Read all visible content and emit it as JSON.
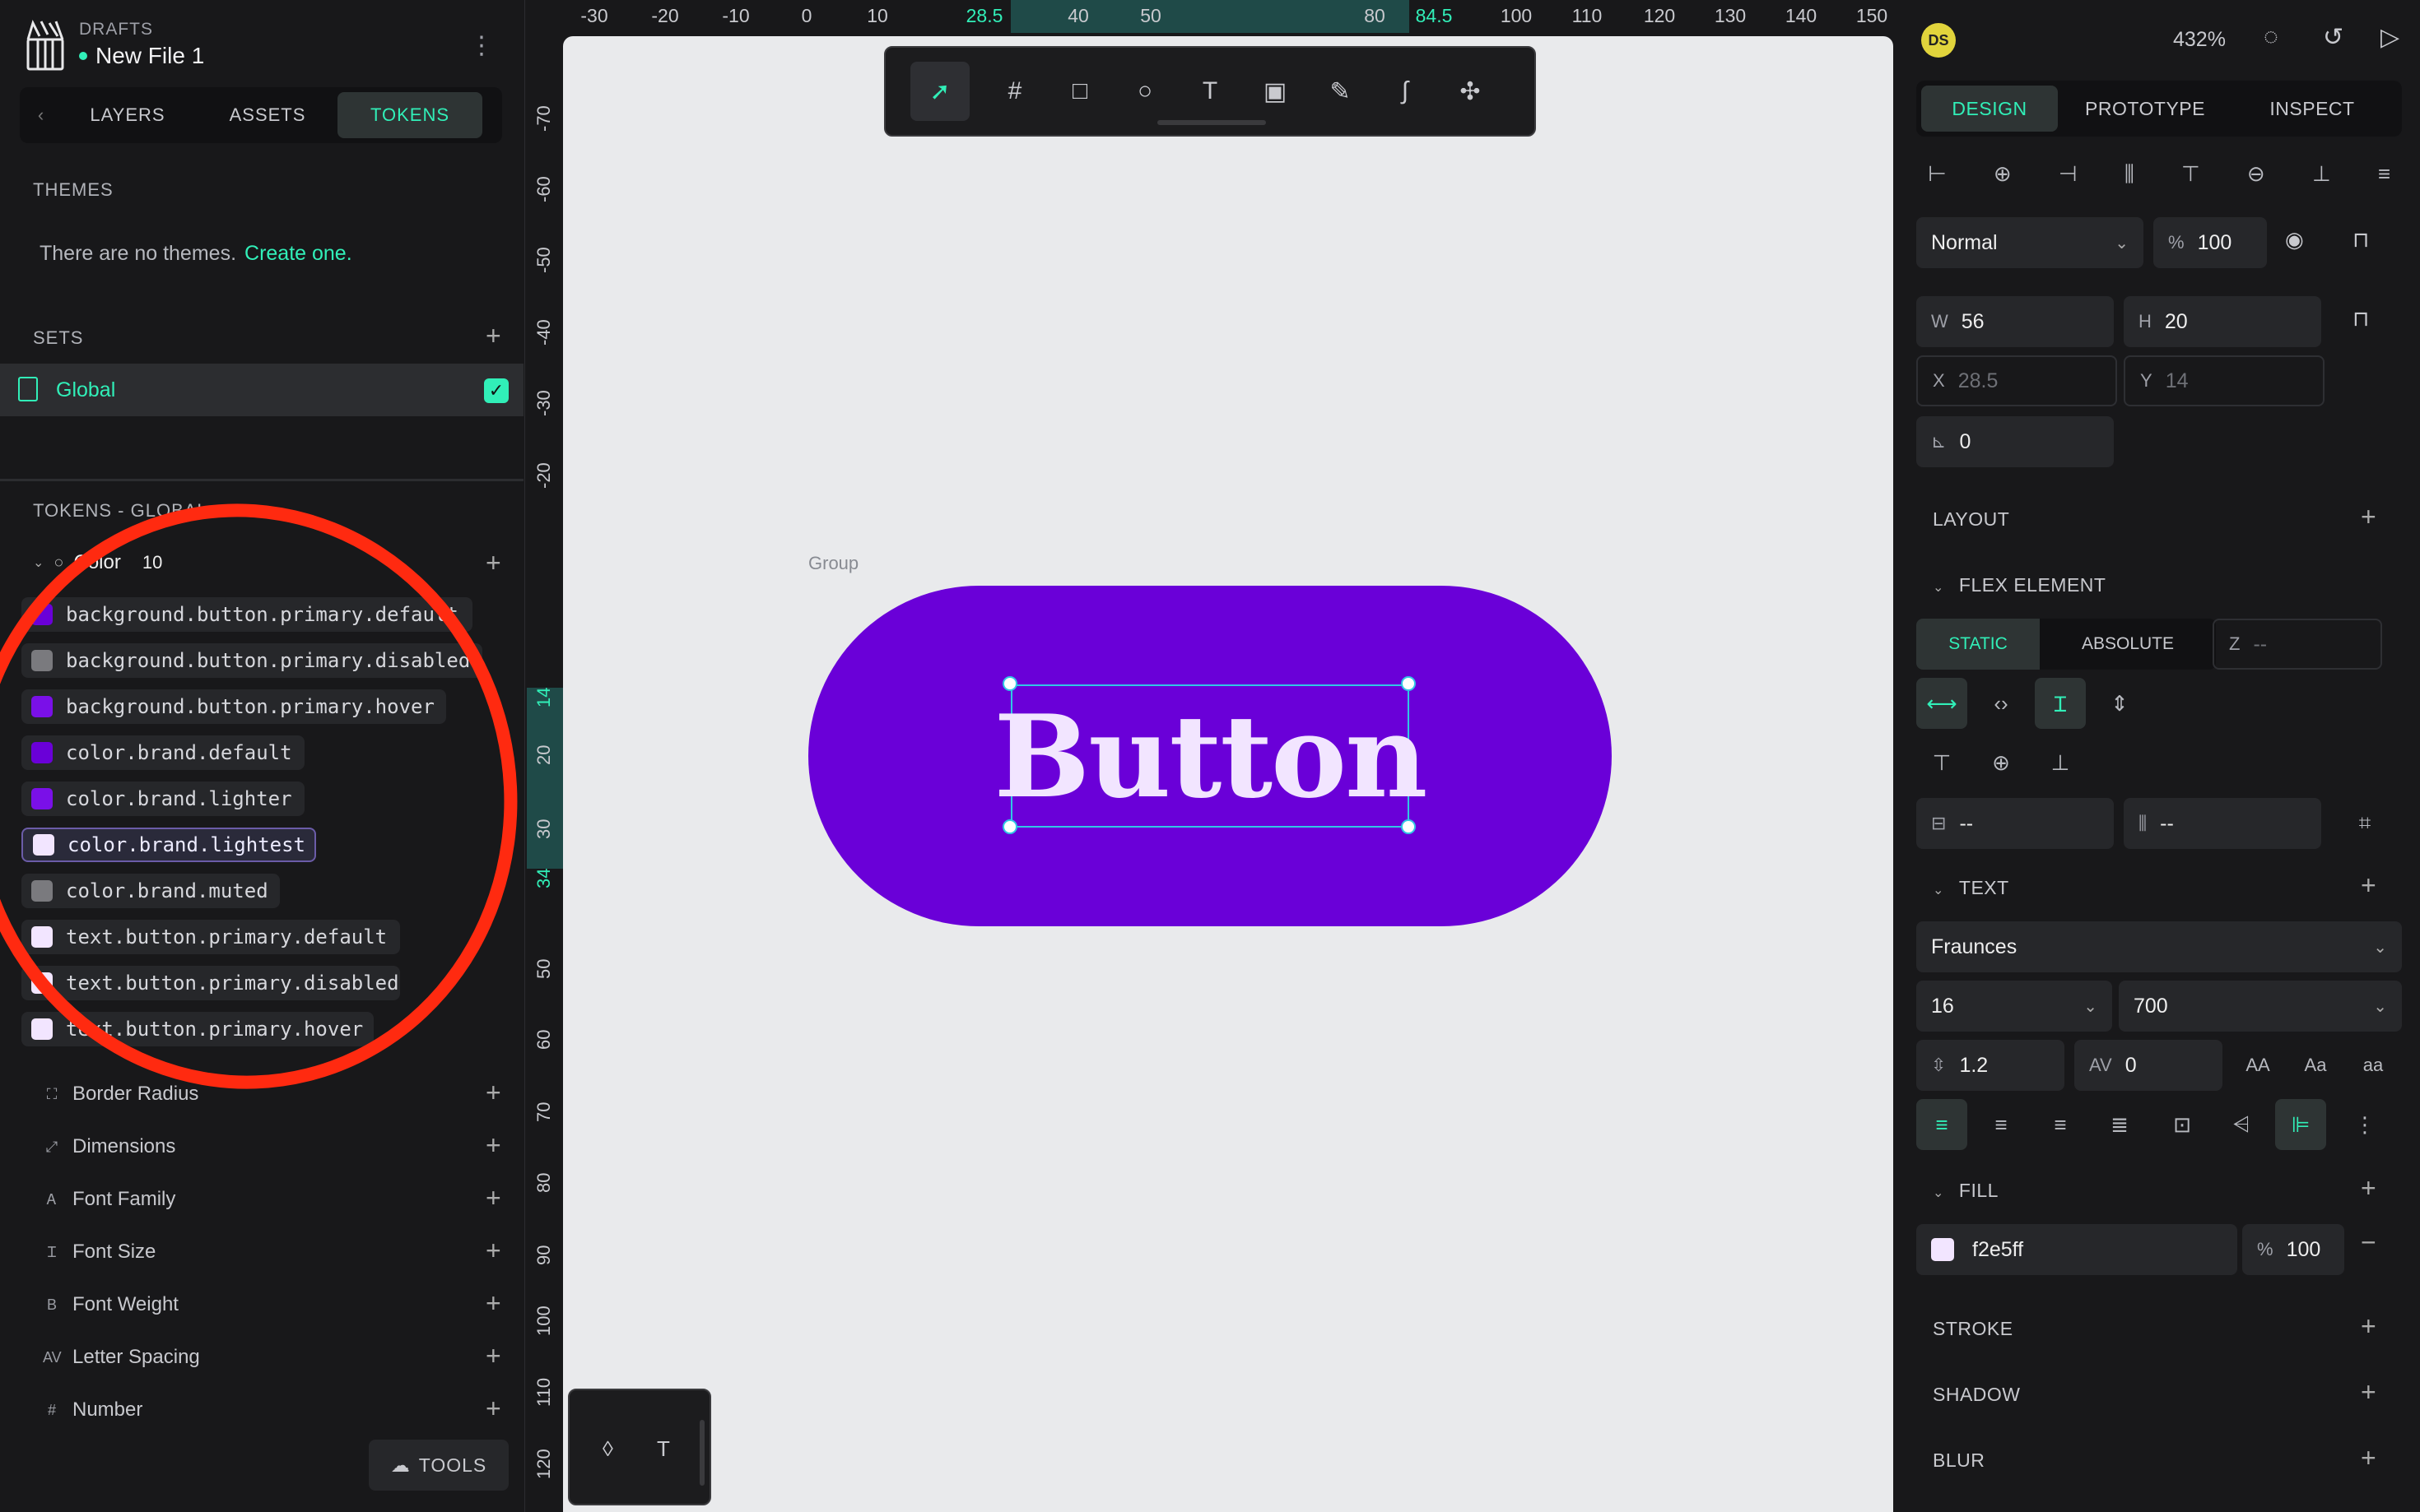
{
  "header": {
    "drafts": "DRAFTS",
    "file_name": "New File 1"
  },
  "left_tabs": [
    "LAYERS",
    "ASSETS",
    "TOKENS"
  ],
  "themes": {
    "title": "THEMES",
    "empty_text": "There are no themes.",
    "create_link": "Create one."
  },
  "sets": {
    "title": "SETS",
    "items": [
      {
        "label": "Global",
        "checked": true
      }
    ]
  },
  "tokens": {
    "title": "TOKENS - GLOBAL",
    "color_group": {
      "label": "Color",
      "count": "10"
    },
    "color_tokens": [
      {
        "name": "background.button.primary.default",
        "color": "#6a00d8"
      },
      {
        "name": "background.button.primary.disabled",
        "color": "#7a7a7e"
      },
      {
        "name": "background.button.primary.hover",
        "color": "#7a10e8"
      },
      {
        "name": "color.brand.default",
        "color": "#6a00d8"
      },
      {
        "name": "color.brand.lighter",
        "color": "#7a10e8"
      },
      {
        "name": "color.brand.lightest",
        "color": "#f2e5ff"
      },
      {
        "name": "color.brand.muted",
        "color": "#7a7a7e"
      },
      {
        "name": "text.button.primary.default",
        "color": "#f2e5ff"
      },
      {
        "name": "text.button.primary.disabled",
        "color": "#f2e5ff"
      },
      {
        "name": "text.button.primary.hover",
        "color": "#f2e5ff"
      }
    ],
    "categories": [
      "Border Radius",
      "Dimensions",
      "Font Family",
      "Font Size",
      "Font Weight",
      "Letter Spacing",
      "Number"
    ]
  },
  "tools_button": "TOOLS",
  "ruler_top": [
    "-30",
    "-20",
    "-10",
    "0",
    "10",
    "28.5",
    "40",
    "50",
    "80",
    "84.5",
    "100",
    "110",
    "120",
    "130",
    "140",
    "150"
  ],
  "ruler_left": [
    "-70",
    "-60",
    "-50",
    "-40",
    "-30",
    "-20",
    "14",
    "20",
    "30",
    "34",
    "50",
    "60",
    "70",
    "80",
    "90",
    "100",
    "110",
    "120"
  ],
  "canvas": {
    "group_label": "Group",
    "button_text": "Button"
  },
  "right": {
    "avatar": "DS",
    "zoom": "432%",
    "tabs": [
      "DESIGN",
      "PROTOTYPE",
      "INSPECT"
    ],
    "blend_mode": "Normal",
    "opacity": "100",
    "w": "56",
    "h": "20",
    "x": "28.5",
    "y": "14",
    "radius": "0",
    "layout_title": "LAYOUT",
    "flex_title": "FLEX ELEMENT",
    "flex_static": "STATIC",
    "flex_absolute": "ABSOLUTE",
    "z_value": "--",
    "margin_v": "--",
    "margin_h": "--",
    "text_title": "TEXT",
    "font_family": "Fraunces",
    "font_size": "16",
    "font_weight": "700",
    "line_height": "1.2",
    "letter_spacing": "0",
    "case_upper": "AA",
    "case_title": "Aa",
    "case_lower": "aa",
    "fill_title": "FILL",
    "fill_hex": "f2e5ff",
    "fill_color": "#f2e5ff",
    "fill_opacity": "100",
    "stroke_title": "STROKE",
    "shadow_title": "SHADOW",
    "blur_title": "BLUR"
  },
  "accent": "#31efb8",
  "brand_purple": "#6a00d8"
}
